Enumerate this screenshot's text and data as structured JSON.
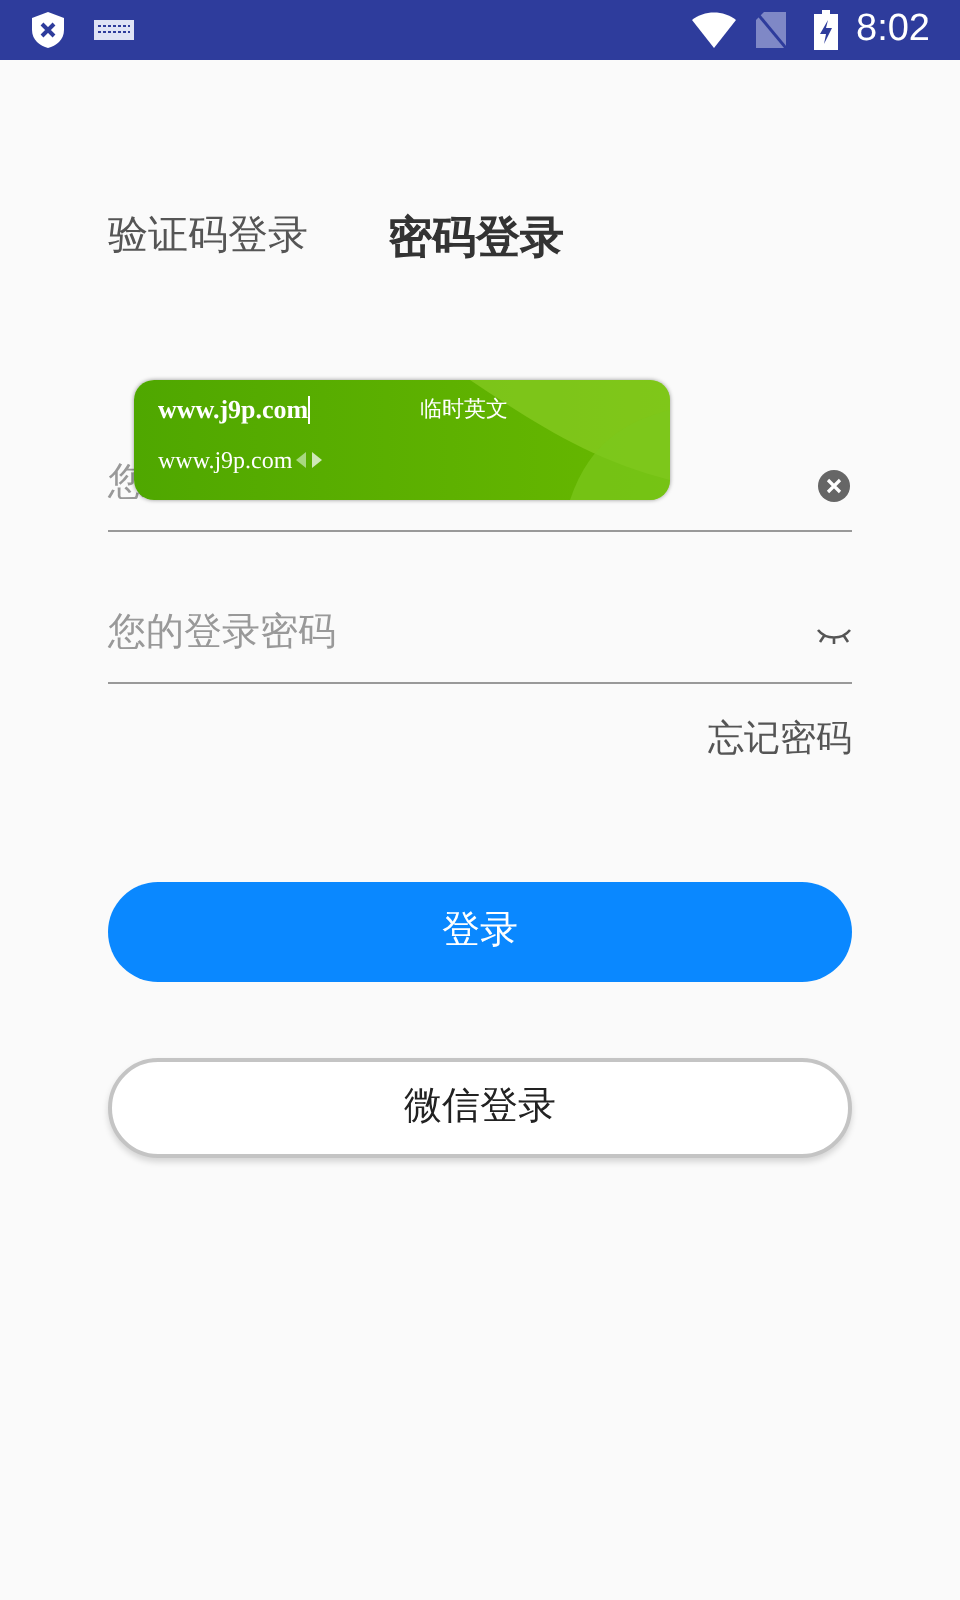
{
  "status_bar": {
    "time": "8:02"
  },
  "tabs": [
    {
      "label": "验证码登录",
      "selected": false
    },
    {
      "label": "密码登录",
      "selected": true
    }
  ],
  "account_field": {
    "placeholder": "您"
  },
  "password_field": {
    "placeholder": "您的登录密码"
  },
  "forgot_link": "忘记密码",
  "login_button": "登录",
  "wechat_button": "微信登录",
  "ime_popup": {
    "composing": "www.j9p.com",
    "mode": "临时英文",
    "candidate": "www.j9p.com"
  }
}
